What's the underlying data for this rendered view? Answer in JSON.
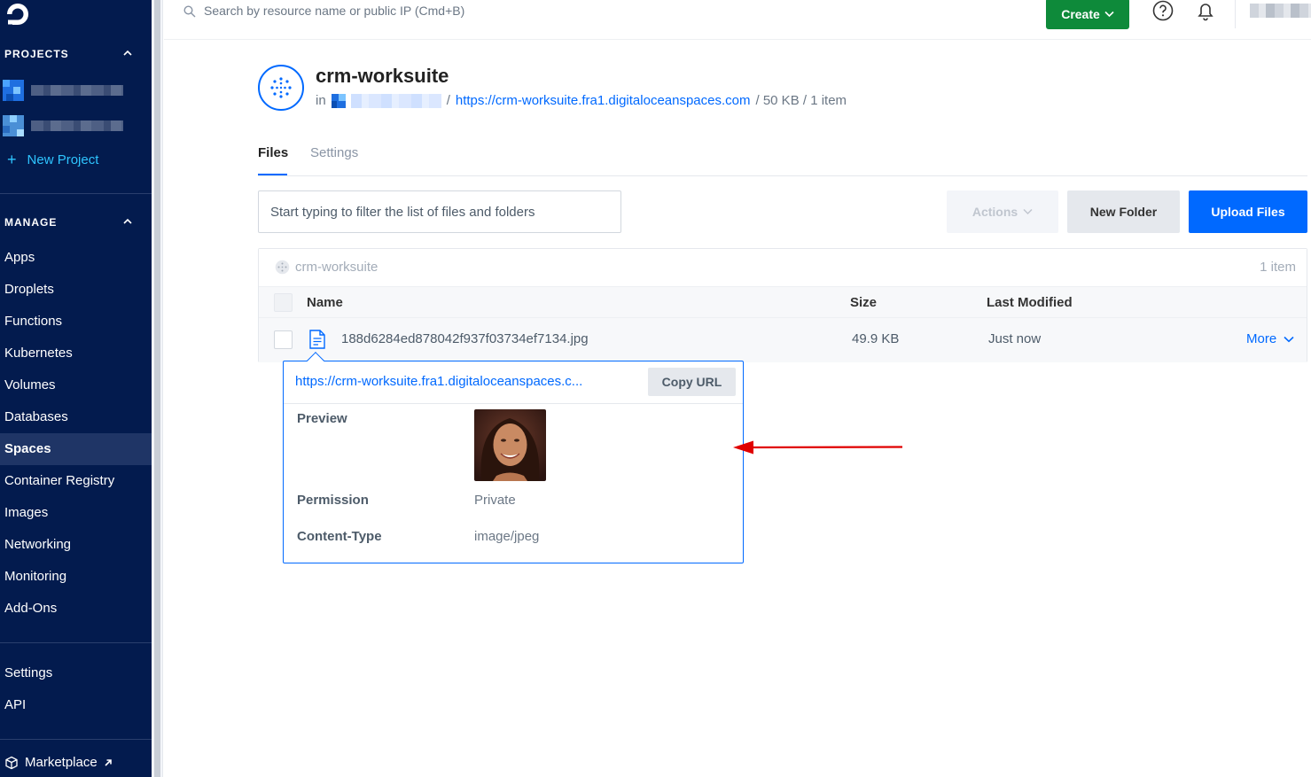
{
  "sidebar": {
    "projects_title": "PROJECTS",
    "new_project_label": "New Project",
    "manage_title": "MANAGE",
    "manage_items": [
      {
        "label": "Apps"
      },
      {
        "label": "Droplets"
      },
      {
        "label": "Functions"
      },
      {
        "label": "Kubernetes"
      },
      {
        "label": "Volumes"
      },
      {
        "label": "Databases"
      },
      {
        "label": "Spaces",
        "active": true
      },
      {
        "label": "Container Registry"
      },
      {
        "label": "Images"
      },
      {
        "label": "Networking"
      },
      {
        "label": "Monitoring"
      },
      {
        "label": "Add-Ons"
      }
    ],
    "bottom_items": [
      {
        "label": "Settings"
      },
      {
        "label": "API"
      }
    ],
    "marketplace_label": "Marketplace"
  },
  "topbar": {
    "search_placeholder": "Search by resource name or public IP (Cmd+B)",
    "create_label": "Create"
  },
  "space": {
    "name": "crm-worksuite",
    "in_label": "in",
    "url": "https://crm-worksuite.fra1.digitaloceanspaces.com",
    "size_summary": "/ 50 KB / 1 item"
  },
  "tabs": [
    {
      "label": "Files",
      "active": true
    },
    {
      "label": "Settings",
      "active": false
    }
  ],
  "toolbar": {
    "filter_placeholder": "Start typing to filter the list of files and folders",
    "actions_label": "Actions",
    "new_folder_label": "New Folder",
    "upload_label": "Upload Files"
  },
  "table": {
    "bucket_name": "crm-worksuite",
    "item_count": "1 item",
    "columns": {
      "name": "Name",
      "size": "Size",
      "modified": "Last Modified"
    },
    "rows": [
      {
        "name": "188d6284ed878042f937f03734ef7134.jpg",
        "size": "49.9 KB",
        "modified": "Just now",
        "more": "More"
      }
    ]
  },
  "popover": {
    "url": "https://crm-worksuite.fra1.digitaloceanspaces.c...",
    "copy_label": "Copy URL",
    "preview_label": "Preview",
    "permission_label": "Permission",
    "permission_value": "Private",
    "content_type_label": "Content-Type",
    "content_type_value": "image/jpeg"
  },
  "colors": {
    "sidebar_bg": "#031b4e",
    "accent_blue": "#0069ff",
    "create_green": "#0e8a3a",
    "annotation_red": "#e00000"
  }
}
